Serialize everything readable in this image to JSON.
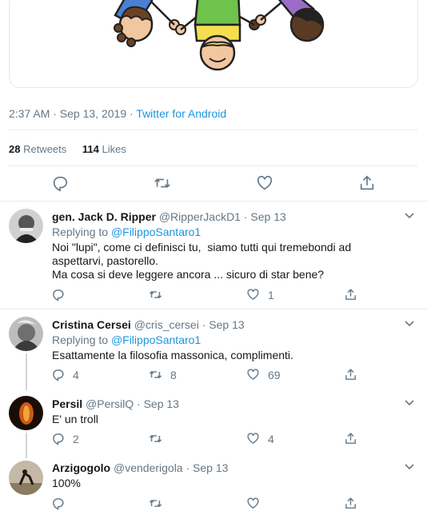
{
  "tweet": {
    "time": "2:37 AM · Sep 13, 2019 · ",
    "via": "Twitter for Android",
    "retweets": "28",
    "retweets_label": " Retweets",
    "likes": "114",
    "likes_label": " Likes"
  },
  "replies": [
    {
      "name": "gen. Jack D. Ripper",
      "meta": " @RipperJackD1 · Sep 13",
      "replying": "Replying to ",
      "replying_to": "@FilippoSantaro1",
      "text": "Noi \"lupi\", come ci definisci tu,  siamo tutti qui tremebondi ad aspettarvi, pastorello.\nMa cosa si deve leggere ancora ... sicuro di star bene?",
      "retweets": "",
      "likes": "1"
    },
    {
      "name": "Cristina Cersei",
      "meta": " @cris_cersei · Sep 13",
      "replying": "Replying to ",
      "replying_to": "@FilippoSantaro1",
      "text": "Esattamente la filosofia massonica, complimenti.",
      "comments": "4",
      "retweets": "8",
      "likes": "69"
    },
    {
      "name": "Persil",
      "meta": " @PersilQ · Sep 13",
      "text": "E' un troll",
      "comments": "2",
      "likes": "4"
    },
    {
      "name": "Arzigogolo",
      "meta": " @venderigola · Sep 13",
      "text": "100%"
    }
  ],
  "colors": {
    "link": "#1b95e0",
    "muted": "#657786",
    "border": "#e6ecf0"
  }
}
